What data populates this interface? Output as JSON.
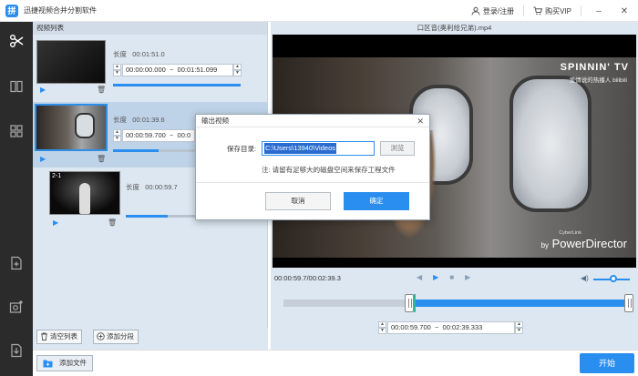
{
  "app": {
    "title": "迅捷视频合并分割软件",
    "logo_char": "拼"
  },
  "titlebar": {
    "login_label": "登录/注册",
    "vip_label": "购买VIP",
    "minimize": "–",
    "close": "✕"
  },
  "list": {
    "header": "视频列表",
    "clips": [
      {
        "index": "",
        "length_label": "长度",
        "length": "00:01:51.0",
        "start": "00:00:00.000",
        "separator": "~",
        "end": "00:01:51.099",
        "progress": 1.0
      },
      {
        "index": "",
        "length_label": "长度",
        "length": "00:01:39.6",
        "start": "00:00:59.700",
        "separator": "~",
        "end": "00:0",
        "progress": 0.55
      },
      {
        "index": "2-1",
        "length_label": "长度",
        "length": "00:00:59.7",
        "start": "",
        "separator": "",
        "end": "",
        "progress": 0.6
      }
    ],
    "clear_label": "清空列表",
    "add_segment_label": "添加分段"
  },
  "video": {
    "title": "口区音(奥利给兄弟).mp4",
    "watermark": "SPINNIN' TV",
    "watermark_sub": "爱情说的热播人 bilibili",
    "brand_by": "by",
    "brand": "PowerDirector",
    "brand_small": "CyberLink",
    "time_readout": "00:00:59.7/00:02:39.3",
    "range_start": "00:00:59.700",
    "range_separator": "~",
    "range_end": "00:02:39.333",
    "volume_level": 0.55,
    "range_fraction_start": 0.375,
    "range_fraction_end": 1.0
  },
  "bottom": {
    "add_file_label": "添加文件",
    "start_label": "开始"
  },
  "modal": {
    "title": "输出视频",
    "close": "✕",
    "dir_label": "保存目录:",
    "dir_value": "C:\\Users\\13940\\Videos",
    "browse_label": "浏览",
    "note": "注:    请留有足够大的磁盘空间来保存工程文件",
    "cancel_label": "取消",
    "ok_label": "确定"
  },
  "colors": {
    "accent": "#2a8ef0",
    "rail": "#2b2b2b",
    "panel": "#dde7f1"
  }
}
